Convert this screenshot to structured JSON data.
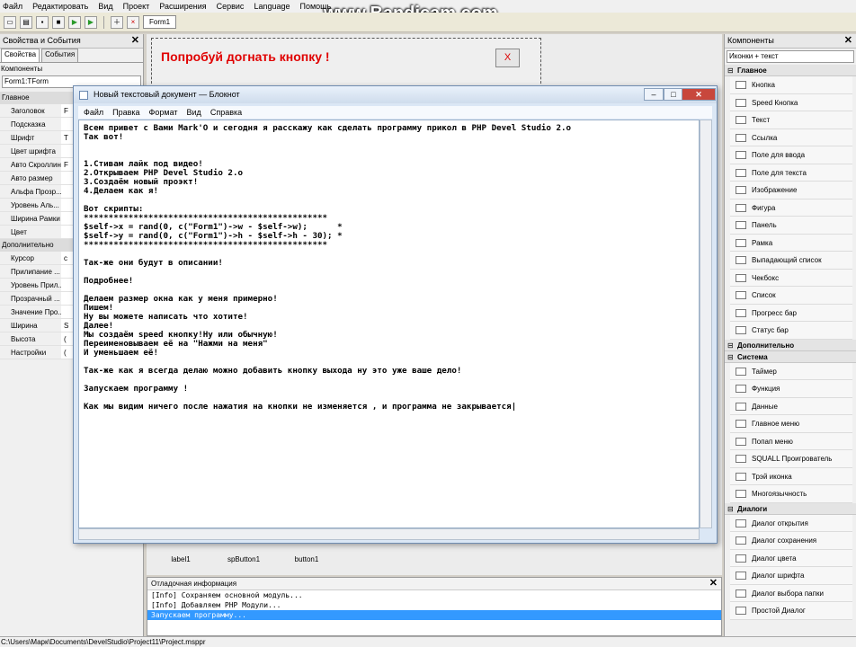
{
  "menubar": [
    "Файл",
    "Редактировать",
    "Вид",
    "Проект",
    "Расширения",
    "Сервис",
    "Language",
    "Помощь"
  ],
  "watermark": "www.Bandicam.com",
  "toolbar": {
    "form_tab": "Form1"
  },
  "left_panel": {
    "title": "Свойства и События",
    "tabs": [
      "Свойства",
      "События"
    ],
    "components_label": "Компоненты",
    "component_selected": "Form1:TForm",
    "categories": [
      "Главное",
      "Дополнительно"
    ],
    "props_main": [
      {
        "k": "Заголовок",
        "v": "F"
      },
      {
        "k": "Подсказка",
        "v": ""
      },
      {
        "k": "Шрифт",
        "v": "T"
      },
      {
        "k": "Цвет шрифта",
        "v": ""
      },
      {
        "k": "Авто Скроллинг",
        "v": "F"
      },
      {
        "k": "Авто размер",
        "v": ""
      },
      {
        "k": "Альфа Прозр...",
        "v": ""
      },
      {
        "k": "Уровень Аль...",
        "v": ""
      },
      {
        "k": "Ширина Рамки",
        "v": ""
      },
      {
        "k": "Цвет",
        "v": ""
      }
    ],
    "props_extra": [
      {
        "k": "Курсор",
        "v": "c"
      },
      {
        "k": "Прилипание ...",
        "v": ""
      },
      {
        "k": "Уровень Прил...",
        "v": ""
      },
      {
        "k": "Прозрачный ...",
        "v": ""
      },
      {
        "k": "Значение Про...",
        "v": ""
      },
      {
        "k": "Ширина",
        "v": "S"
      },
      {
        "k": "Высота",
        "v": "("
      },
      {
        "k": "Настройки",
        "v": "("
      }
    ]
  },
  "design": {
    "form_title": "Попробуй догнать кнопку !",
    "close_btn": "X",
    "components": [
      "label1",
      "spButton1",
      "button1"
    ]
  },
  "notepad": {
    "title": "Новый текстовый документ — Блокнот",
    "menu": [
      "Файл",
      "Правка",
      "Формат",
      "Вид",
      "Справка"
    ],
    "text": "Всем привет с Вами Mark'O и сегодня я расскажу как сделать программу прикол в PHP Devel Studio 2.o\nТак вот!\n\n\n1.Стивам лайк под видео!\n2.Открываем PHP Devel Studio 2.o\n3.Создаём новый проэкт!\n4.Делаем как я!\n\nВот скрипты:\n*************************************************\n$self->x = rand(0, c(\"Form1\")->w - $self->w);      *\n$self->y = rand(0, c(\"Form1\")->h - $self->h - 30); *\n*************************************************\n\nТак-же они будут в описании!\n\nПодробнее!\n\nДелаем размер окна как у меня примерно!\nПишем!\nНу вы можете написать что хотите!\nДалее!\nМы создаём speed кнопку!Ну или обычную!\nПереименовываем её на \"Нажми на меня\"\nИ уменьшаем её!\n\nТак-же как я всегда делаю можно добавить кнопку выхода ну это уже ваше дело!\n\nЗапускаем программу !\n\nКак мы видим ничего после нажатия на кнопки не изменяется , и программа не закрывается|"
  },
  "output": {
    "title": "Отладочная информация",
    "lines": [
      "[Info] Сохраняем основной модуль...",
      "[Info] Добавляем PHP Модули...",
      "Запускаем программу..."
    ]
  },
  "right_panel": {
    "title": "Компоненты",
    "view_mode": "Иконки + текст",
    "cat_main": "Главное",
    "items_main": [
      "Кнопка",
      "Speed Кнопка",
      "Текст",
      "Ссылка",
      "Поле для ввода",
      "Поле для текста",
      "Изображение",
      "Фигура",
      "Панель",
      "Рамка",
      "Выпадающий список",
      "Чекбокс",
      "Список",
      "Прогресс бар",
      "Статус бар"
    ],
    "cat_extra": "Дополнительно",
    "cat_system": "Система",
    "items_system": [
      "Таймер",
      "Функция",
      "Данные",
      "Главное меню",
      "Попап меню",
      "SQUALL Проигрователь",
      "Трэй иконка",
      "Многоязычность"
    ],
    "cat_dialogs": "Диалоги",
    "items_dialogs": [
      "Диалог открытия",
      "Диалог сохранения",
      "Диалог цвета",
      "Диалог шрифта",
      "Диалог выбора папки",
      "Простой Диалог"
    ]
  },
  "statusbar": "C:\\Users\\Марк\\Documents\\DevelStudio\\Project11\\Project.msppr"
}
